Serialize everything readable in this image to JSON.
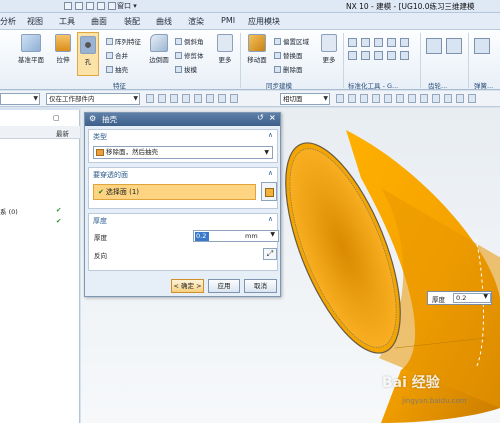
{
  "titlebar": {
    "window_menu": "窗口 ▾",
    "title": "NX 10 - 建模 - [UG10.0练习三维建模"
  },
  "menubar": [
    {
      "label": "分析"
    },
    {
      "label": "视图"
    },
    {
      "label": "工具"
    },
    {
      "label": "曲面"
    },
    {
      "label": "装配"
    },
    {
      "label": "曲线"
    },
    {
      "label": "渲染"
    },
    {
      "label": "PMI"
    },
    {
      "label": "应用模块"
    }
  ],
  "ribbon": {
    "datum_plane": "基准平面",
    "extrude": "拉伸",
    "hole": "孔",
    "pattern_feature": "阵列特征",
    "unite": "合并",
    "shell": "抽壳",
    "edge_blend": "边倒圆",
    "chamfer": "倒斜角",
    "trim_body": "修剪体",
    "draft": "拔模",
    "more1": "更多",
    "move_face": "移动面",
    "offset_region": "偏置区域",
    "replace_face": "替换面",
    "delete_face": "删除面",
    "more2": "更多",
    "group_feature": "特征",
    "group_sync": "同步建模",
    "group_std": "标准化工具 - G...",
    "group_gear": "齿轮...",
    "group_spring": "弹簧..."
  },
  "selbar": {
    "filter": "",
    "scope": "仅在工作部件内",
    "face_rule": "相切面"
  },
  "navigator": {
    "col_latest": "最新",
    "rows": [
      {
        "label": "系 (0)",
        "check": "✔"
      },
      {
        "label": "",
        "check": "✔"
      }
    ]
  },
  "dialog": {
    "title": "抽壳",
    "type_header": "类型",
    "type_value": "移除面，然后抽壳",
    "faces_header": "要穿透的面",
    "faces_value": "选择面 (1)",
    "thickness_header": "厚度",
    "thickness_label": "厚度",
    "thickness_value": "0.2",
    "thickness_unit": "mm",
    "reverse_label": "反向",
    "ok": "< 确定 >",
    "apply": "应用",
    "cancel": "取消"
  },
  "viewport_field": {
    "label": "厚度",
    "value": "0.2"
  },
  "watermark": {
    "text": "Bai 经验",
    "url": "jingyan.baidu.com"
  },
  "colors": {
    "body_orange": "#f5a200",
    "selection": "#fdd481",
    "dialog_title": "#4a6c96"
  }
}
